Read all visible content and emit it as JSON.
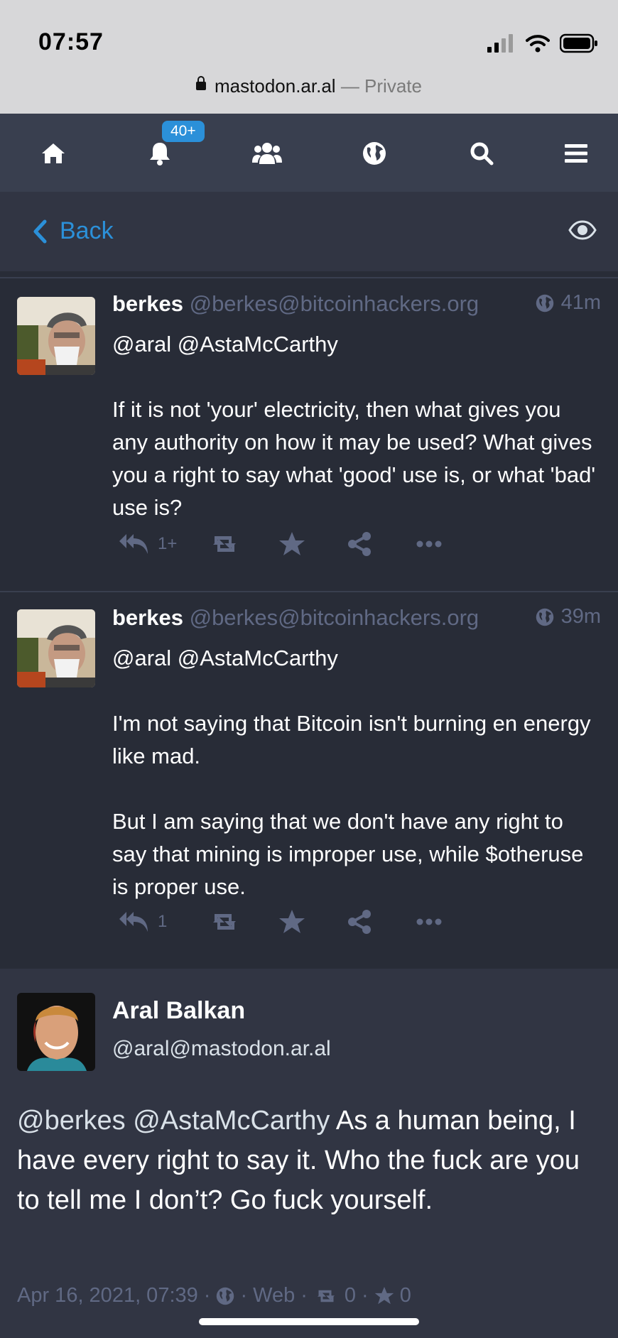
{
  "status_bar": {
    "time": "07:57"
  },
  "browser": {
    "domain": "mastodon.ar.al",
    "mode": "— Private"
  },
  "nav": {
    "notifications_badge": "40+",
    "icons": [
      "home-icon",
      "bell-icon",
      "people-icon",
      "globe-icon",
      "search-icon",
      "menu-icon"
    ]
  },
  "column_header": {
    "back_label": "Back"
  },
  "statuses": [
    {
      "display_name": "berkes",
      "acct": "@berkes@bitcoinhackers.org",
      "time": "41m",
      "mentions": "@aral @AstaMcCarthy",
      "paragraphs": [
        "If it is not 'your' electricity, then what gives you any authority on how it may be used? What gives you a right to say what 'good' use is, or what 'bad' use is?"
      ],
      "reply_count": "1+"
    },
    {
      "display_name": "berkes",
      "acct": "@berkes@bitcoinhackers.org",
      "time": "39m",
      "mentions": "@aral @AstaMcCarthy",
      "paragraphs": [
        "I'm not saying that Bitcoin isn't burning en energy like mad.",
        "But I am saying that we don't have any right to say that mining is improper use, while $otheruse is proper use."
      ],
      "reply_count": "1"
    }
  ],
  "detailed_status": {
    "display_name": "Aral Balkan",
    "acct": "@aral@mastodon.ar.al",
    "mentions": "@berkes @AstaMcCarthy",
    "text": " As a human being, I have every right to say it. Who the fuck are you to tell me I don’t? Go fuck yourself.",
    "date": "Apr 16, 2021, 07:39",
    "application": "Web",
    "boosts": "0",
    "favourites": "0"
  },
  "colors": {
    "accent": "#2b90d9",
    "background": "#282c37",
    "muted": "#606984"
  }
}
